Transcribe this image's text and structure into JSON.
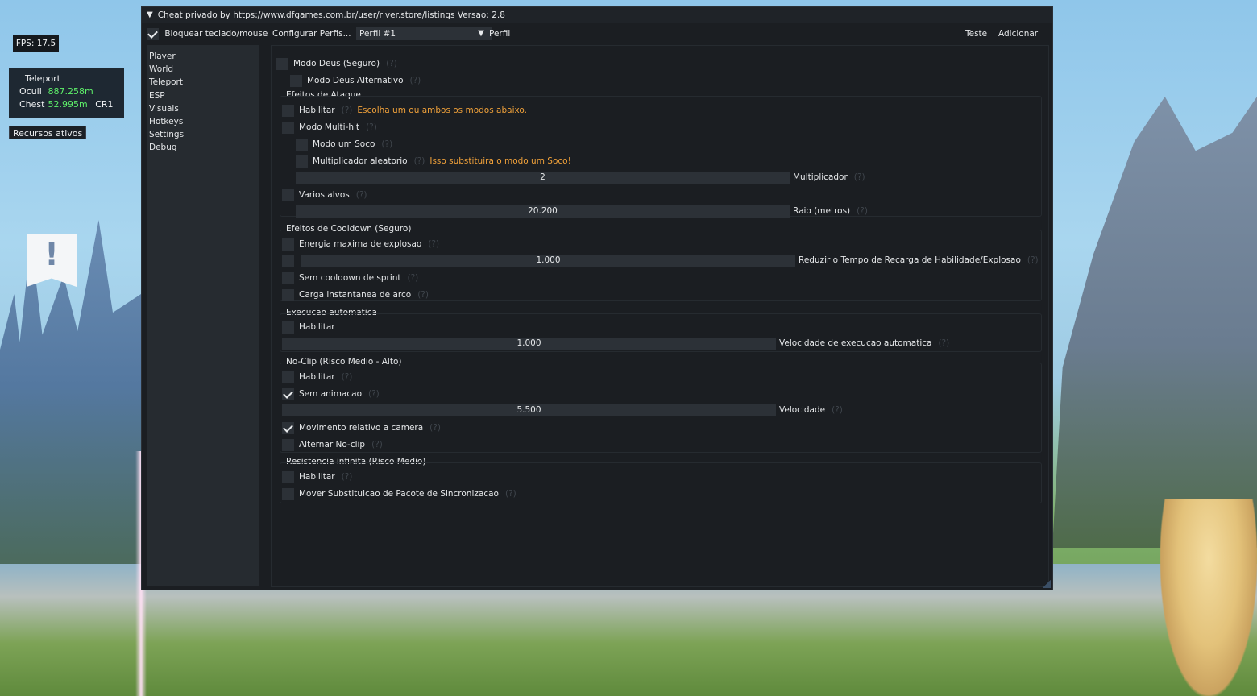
{
  "hud": {
    "fps": "FPS: 17.5",
    "info": {
      "title": "Teleport",
      "rows": [
        {
          "label": "Oculi",
          "value": "887.258m",
          "extra": ""
        },
        {
          "label": "Chest",
          "value": "52.995m",
          "extra": "CR1"
        }
      ]
    },
    "active_features": "Recursos ativos"
  },
  "window": {
    "title": "Cheat privado by https://www.dfgames.com.br/user/river.store/listings Versao: 2.8",
    "toolbar": {
      "block_input_label": "Bloquear teclado/mouse",
      "block_input_checked": true,
      "config_profiles": "Configurar Perfis...",
      "profile_selected": "Perfil #1",
      "profile_label": "Perfil",
      "test": "Teste",
      "add": "Adicionar"
    },
    "sidebar": [
      "Player",
      "World",
      "Teleport",
      "ESP",
      "Visuals",
      "Hotkeys",
      "Settings",
      "Debug"
    ],
    "help_mark": "(?)",
    "content": {
      "god_mode": "Modo Deus (Seguro)",
      "god_mode_alt": "Modo Deus Alternativo",
      "attack": {
        "header": "Efeitos de Ataque",
        "enable": "Habilitar",
        "enable_hint": "Escolha um ou ambos os modos abaixo.",
        "multihit": "Modo Multi-hit",
        "one_punch": "Modo um Soco",
        "random_mult": "Multiplicador aleatorio",
        "random_mult_hint": "Isso substituira o modo um Soco!",
        "mult_value": "2",
        "mult_label": "Multiplicador",
        "multi_targets": "Varios alvos",
        "radius_value": "20.200",
        "radius_label": "Raio (metros)"
      },
      "cooldown": {
        "header": "Efeitos de Cooldown (Seguro)",
        "max_burst": "Energia maxima de explosao",
        "reduce_value": "1.000",
        "reduce_label": "Reduzir o Tempo de Recarga de Habilidade/Explosao",
        "no_sprint_cd": "Sem cooldown de sprint",
        "instant_bow": "Carga instantanea de arco"
      },
      "auto_exec": {
        "header": "Execucao automatica",
        "enable": "Habilitar",
        "speed_value": "1.000",
        "speed_label": "Velocidade de execucao automatica"
      },
      "noclip": {
        "header": "No-Clip (Risco Medio - Alto)",
        "enable": "Habilitar",
        "no_anim": "Sem animacao",
        "speed_value": "5.500",
        "speed_label": "Velocidade",
        "camera_rel": "Movimento relativo a camera",
        "toggle": "Alternar No-clip"
      },
      "stamina": {
        "header": "Resistencia infinita (Risco Medio)",
        "enable": "Habilitar",
        "packet_sub": "Mover Substituicao de Pacote de Sincronizacao"
      }
    }
  },
  "colors": {
    "warning": "#f0a13a",
    "distance": "#5ef06a",
    "window_bg": "#1b1e22",
    "frame_bg": "#2c3137"
  }
}
